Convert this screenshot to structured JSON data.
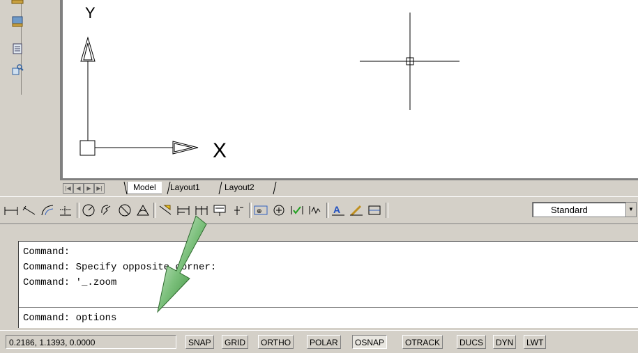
{
  "left_toolbar": {
    "icons": [
      "render-icon",
      "properties-icon",
      "tool-palette-icon"
    ]
  },
  "canvas": {
    "ucs_y_label": "Y",
    "ucs_x_label": "X"
  },
  "layout_tabs": {
    "nav": [
      "|◀",
      "◀",
      "▶",
      "▶|"
    ],
    "tabs": [
      "Model",
      "Layout1",
      "Layout2"
    ],
    "active": "Model"
  },
  "dimension_toolbar": {
    "icons": [
      "linear-dimension-icon",
      "aligned-dimension-icon",
      "arc-length-icon",
      "ordinate-dimension-icon",
      "radius-dimension-icon",
      "jogged-dimension-icon",
      "diameter-dimension-icon",
      "angular-dimension-icon",
      "quick-dimension-icon",
      "baseline-dimension-icon",
      "continue-dimension-icon",
      "quick-leader-icon",
      "tolerance-icon",
      "center-mark-icon",
      "dimension-edit-icon",
      "dimension-text-edit-icon",
      "dimension-update-icon",
      "dimension-style-icon"
    ],
    "style_value": "Standard"
  },
  "command_window": {
    "history": [
      "Command:",
      "Command: Specify opposite corner:",
      "Command: '_.zoom"
    ],
    "current": "Command: options"
  },
  "arrow": {
    "color": "#3a9a3a"
  },
  "status_bar": {
    "coordinates": "0.2186, 1.1393, 0.0000",
    "toggles": [
      {
        "label": "SNAP",
        "on": false
      },
      {
        "label": "GRID",
        "on": false
      },
      {
        "label": "ORTHO",
        "on": false
      },
      {
        "label": "POLAR",
        "on": false
      },
      {
        "label": "OSNAP",
        "on": true
      },
      {
        "label": "OTRACK",
        "on": false
      },
      {
        "label": "DUCS",
        "on": false
      },
      {
        "label": "DYN",
        "on": false
      },
      {
        "label": "LWT",
        "on": false
      }
    ]
  }
}
